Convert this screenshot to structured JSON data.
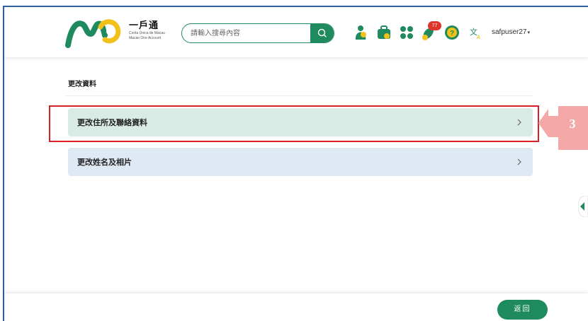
{
  "header": {
    "brand_name": "一戶通",
    "brand_sub_1": "Conta Única de Macau",
    "brand_sub_2": "Macao One Account",
    "search_placeholder": "請輸入搜尋內容",
    "notification_count": "77",
    "username": "safpuser27",
    "user_caret": "▾"
  },
  "page": {
    "title": "更改資料",
    "items": [
      {
        "label": "更改住所及聯絡資料"
      },
      {
        "label": "更改姓名及相片"
      }
    ]
  },
  "annotation": {
    "step_number": "3",
    "color": "#f5a8a8",
    "box_color": "#d81f26"
  },
  "footer": {
    "back_label": "返回"
  },
  "colors": {
    "brand_green": "#1f8a5e",
    "logo_yellow": "#f2c21a",
    "item_address_bg": "#d8ebe4",
    "item_name_bg": "#dfe9f3"
  },
  "icons": [
    "macau-logo",
    "search-icon",
    "services-icon",
    "bag-icon",
    "apps-icon",
    "bell-icon",
    "help-icon",
    "translate-icon",
    "chevron-right-icon",
    "side-tab-icon"
  ]
}
